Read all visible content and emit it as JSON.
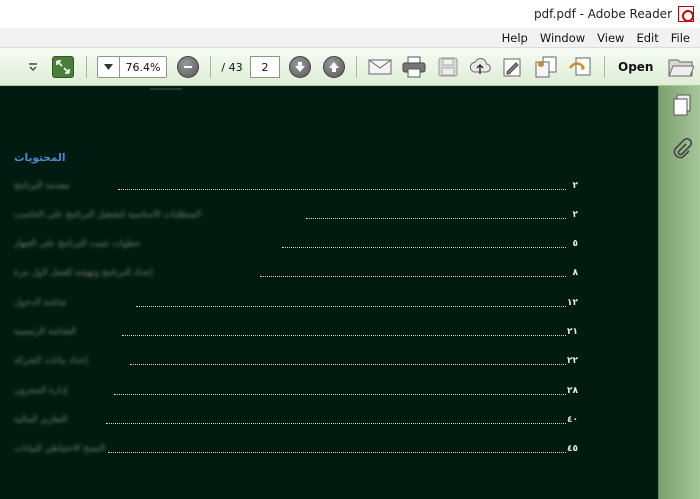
{
  "window": {
    "title": "pdf.pdf - Adobe Reader"
  },
  "menu": {
    "items": [
      "File",
      "Edit",
      "View",
      "Window",
      "Help"
    ]
  },
  "toolbar": {
    "open_label": "Open",
    "page_current": "2",
    "page_total": "/ 43",
    "zoom_value": "76.4%",
    "icons": [
      "folder-open-icon",
      "create-icon",
      "combine-icon",
      "edit-icon",
      "upload-icon",
      "save-icon",
      "print-icon",
      "email-icon",
      "previous-page-icon",
      "next-page-icon",
      "zoom-out-icon",
      "zoom-dropdown-icon",
      "fit-page-icon",
      "toolbar-menu-icon"
    ]
  },
  "side_panel": {
    "icons": [
      "pages-icon",
      "attachments-icon"
    ]
  },
  "document": {
    "toc_heading": "المحتويات",
    "entries": [
      {
        "num": "٢",
        "label": "مقدمة البرنامج"
      },
      {
        "num": "٢",
        "label": "المتطلبات الأساسية لتشغيل البرنامج على الحاسب"
      },
      {
        "num": "٥",
        "label": "خطوات تثبيت البرنامج على الجهاز"
      },
      {
        "num": "٨",
        "label": "إعداد البرنامج وتهيئته للعمل لأول مرة"
      },
      {
        "num": "١٢",
        "label": "شاشة الدخول"
      },
      {
        "num": "٢١",
        "label": "الشاشة الرئيسية"
      },
      {
        "num": "٢٢",
        "label": "إعداد بيانات الشركة"
      },
      {
        "num": "٢٨",
        "label": "إدارة المخزون"
      },
      {
        "num": "٤٠",
        "label": "التقارير المالية"
      },
      {
        "num": "٤٥",
        "label": "النسخ الاحتياطي للبيانات"
      }
    ]
  }
}
